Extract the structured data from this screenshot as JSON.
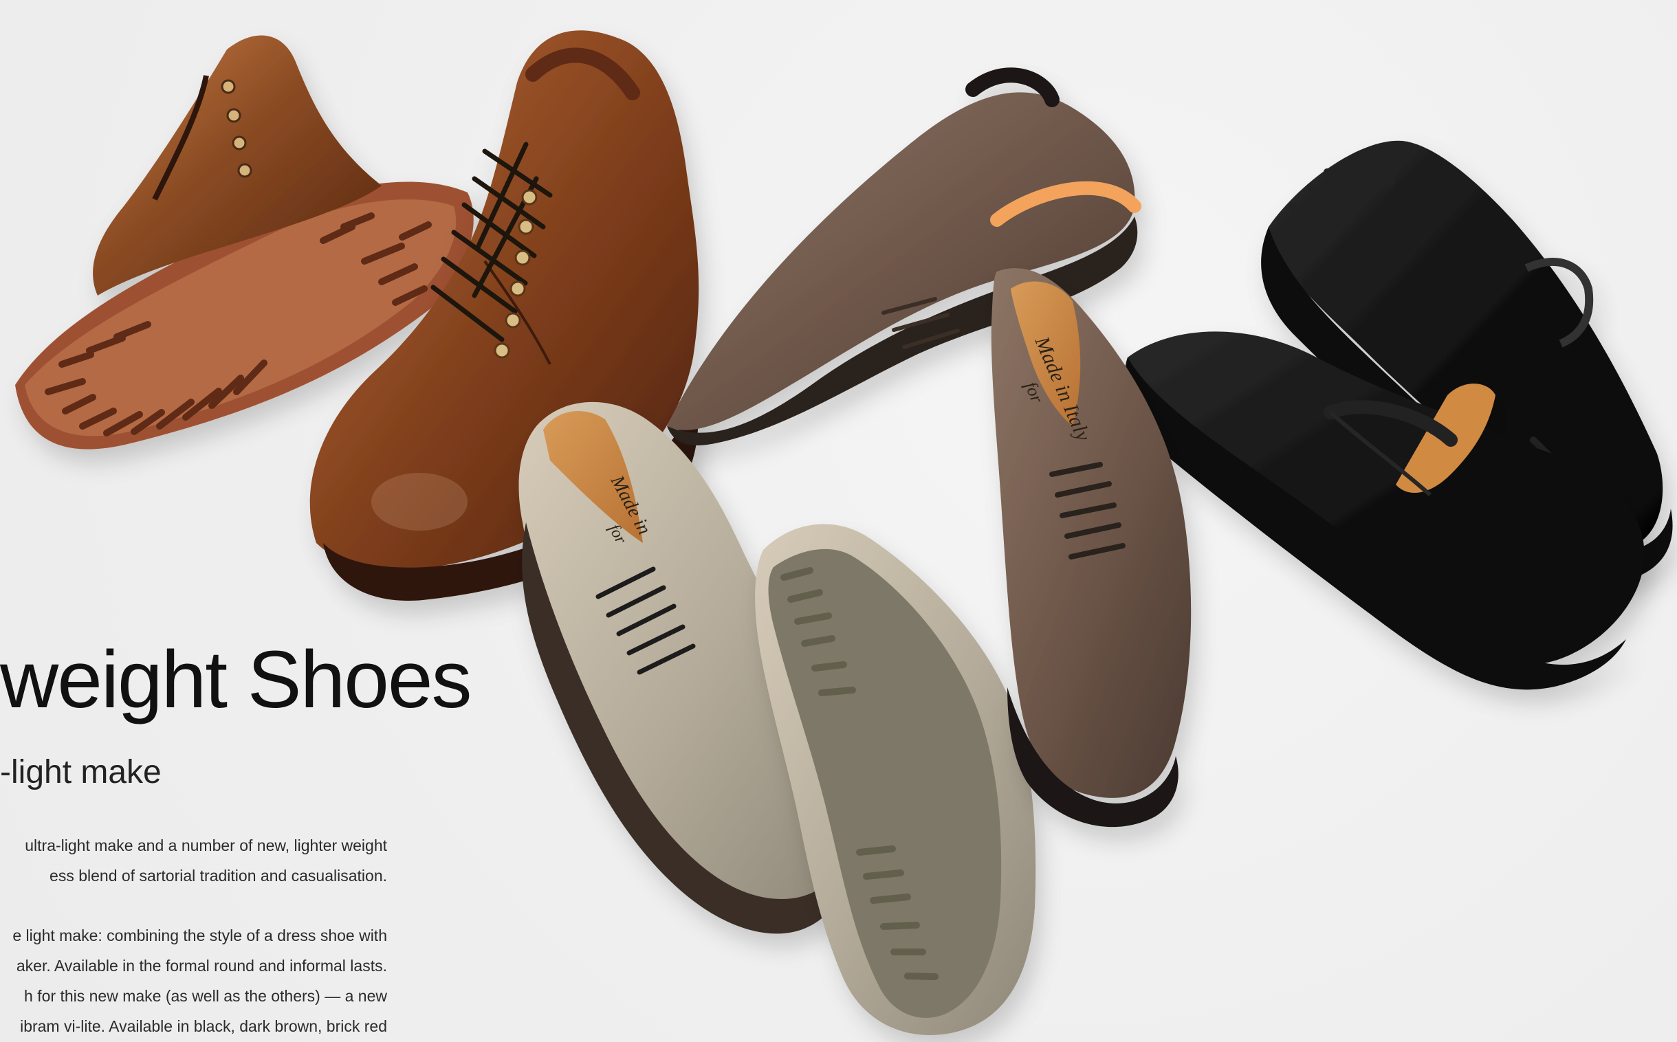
{
  "headline": {
    "title": "weight Shoes",
    "subtitle": "-light make"
  },
  "copy": {
    "paragraph_1": [
      "ultra-light make and a number of new, lighter weight",
      "ess blend of sartorial tradition and casualisation."
    ],
    "paragraph_2": [
      "e light make: combining the style of a dress shoe with",
      "aker. Available in the formal round and informal lasts.",
      "h for this new make (as well as the others) — a new",
      "ibram vi-lite. Available in black, dark brown, brick red"
    ]
  },
  "image_text": {
    "insole_label_1": "Made in Italy",
    "insole_label_2": "Made in",
    "insole_label_3": "for",
    "insole_label_4": "for"
  },
  "colors": {
    "background": "#efefef",
    "brown_leather": "#8a4b23",
    "dark_brown_suede": "#6b5447",
    "taupe_suede": "#b3aa99",
    "black_suede": "#111111",
    "sole_olive": "#7d7867"
  }
}
